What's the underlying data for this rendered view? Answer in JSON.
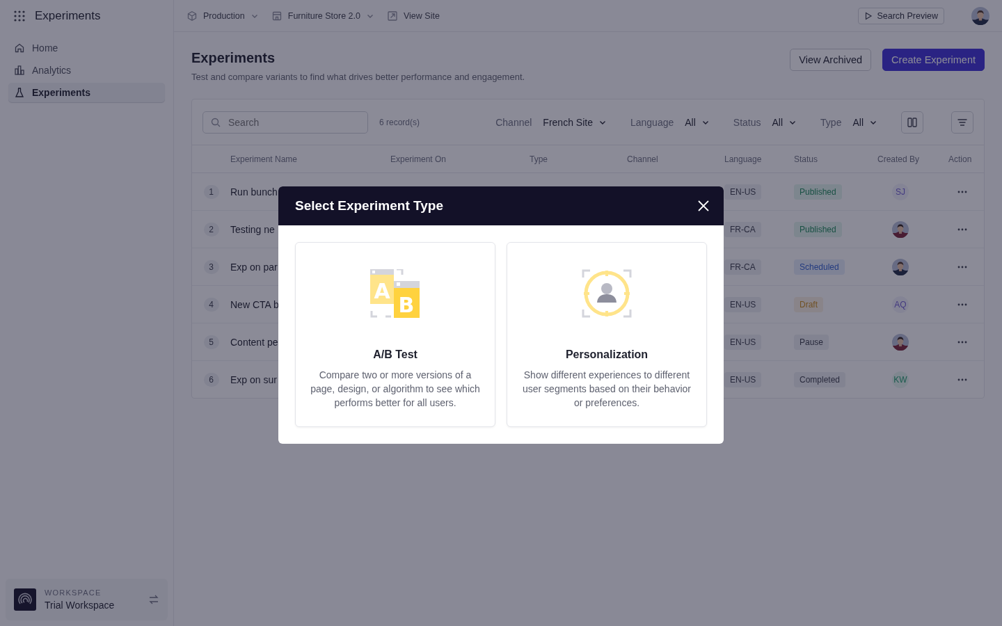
{
  "sidebar": {
    "title": "Experiments",
    "items": [
      {
        "label": "Home",
        "selected": false
      },
      {
        "label": "Analytics",
        "selected": false
      },
      {
        "label": "Experiments",
        "selected": true
      }
    ],
    "workspace": {
      "caption": "WORKSPACE",
      "name": "Trial Workspace"
    }
  },
  "topbar": {
    "items": [
      {
        "label": "Production",
        "dropdown": true
      },
      {
        "label": "Furniture Store 2.0",
        "dropdown": true
      },
      {
        "label": "View Site",
        "dropdown": false
      }
    ],
    "preview_button": "Search Preview"
  },
  "page": {
    "title": "Experiments",
    "subtitle": "Test and compare variants to find what drives better performance and engagement.",
    "buttons": [
      {
        "label": "View Archived",
        "kind": "secondary"
      },
      {
        "label": "Create Experiment",
        "kind": "primary"
      }
    ]
  },
  "toolbar": {
    "search": {
      "placeholder": "Search"
    },
    "count": "6 record(s)",
    "filters": [
      {
        "label": "Channel",
        "value": "French Site"
      },
      {
        "label": "Language",
        "value": "All"
      },
      {
        "label": "Status",
        "value": "All"
      },
      {
        "label": "Type",
        "value": "All"
      }
    ]
  },
  "table": {
    "columns": [
      "Experiment Name",
      "Experiment On",
      "Type",
      "Channel",
      "Language",
      "Status",
      "Created By",
      "Action"
    ],
    "rows": [
      {
        "index": "1",
        "name": "Run bunch",
        "language": "EN-US",
        "status": {
          "label": "Published",
          "kind": "published"
        },
        "creator": {
          "kind": "initials",
          "text": "SJ"
        }
      },
      {
        "index": "2",
        "name": "Testing ne",
        "language": "FR-CA",
        "status": {
          "label": "Published",
          "kind": "published"
        }
      },
      {
        "index": "3",
        "name": "Exp on par",
        "language": "FR-CA",
        "status": {
          "label": "Scheduled",
          "kind": "scheduled"
        }
      },
      {
        "index": "4",
        "name": "New CTA b",
        "language": "EN-US",
        "status": {
          "label": "Draft",
          "kind": "draft"
        },
        "creator": {
          "kind": "initials",
          "text": "AQ"
        }
      },
      {
        "index": "5",
        "name": "Content pe",
        "language": "EN-US",
        "status": {
          "label": "Pause",
          "kind": "pause"
        }
      },
      {
        "index": "6",
        "name": "Exp on sur",
        "language": "EN-US",
        "status": {
          "label": "Completed",
          "kind": "completed"
        },
        "creator": {
          "kind": "initials",
          "text": "KW"
        }
      }
    ]
  },
  "modal": {
    "title": "Select Experiment Type",
    "options": [
      {
        "kind": "ab",
        "icon_letters": [
          "A",
          "B"
        ],
        "title": "A/B Test",
        "description": "Compare two or more versions of a page, design, or algorithm to see which performs better for all users."
      },
      {
        "kind": "personalization",
        "title": "Personalization",
        "description": "Show different experiences to different user segments based on their behavior or preferences."
      }
    ]
  }
}
